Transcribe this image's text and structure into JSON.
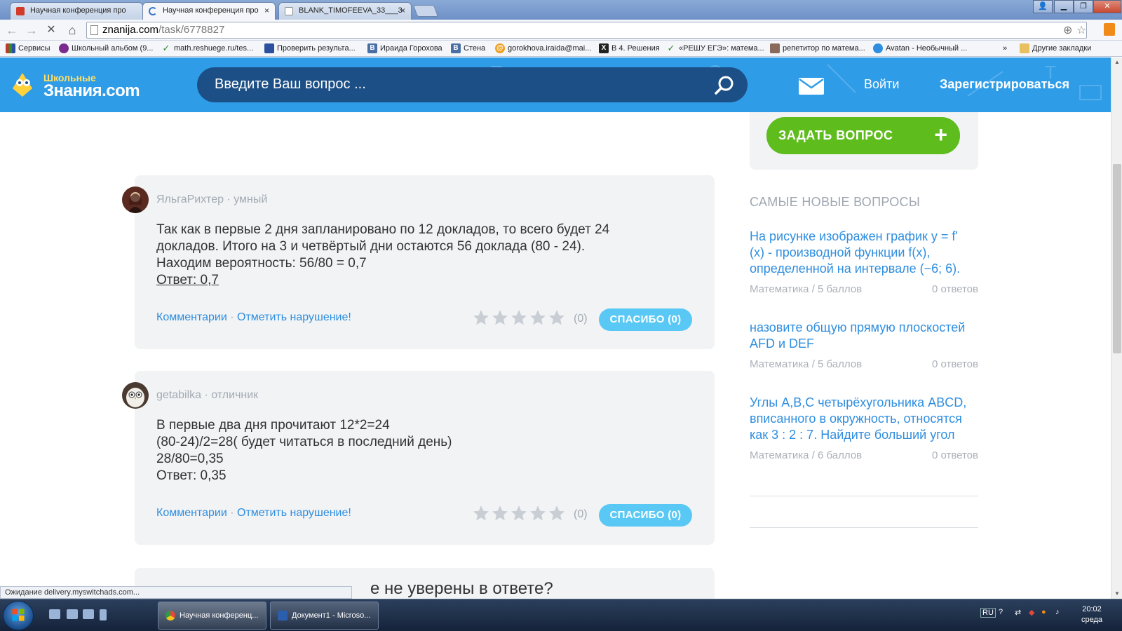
{
  "browser": {
    "tabs": [
      {
        "title": "Научная конференция про",
        "favicon_color": "#d23a2a"
      },
      {
        "title": "Научная конференция про",
        "favicon_color": "#3a73c8"
      },
      {
        "title": "BLANK_TIMOFEEVA_33___3",
        "favicon_color": "#8a8a8a"
      }
    ],
    "url_host": "znanija.com",
    "url_path": "/task/6778827",
    "bookmarks": [
      {
        "label": "Сервисы",
        "icon_color": "#c0392b",
        "glyph": ""
      },
      {
        "label": "Школьный альбом (9...",
        "icon_color": "#7b2b8e",
        "glyph": ""
      },
      {
        "label": "math.reshuege.ru/tes...",
        "icon_color": "#2e8b2e",
        "glyph": "✓"
      },
      {
        "label": "Проверить результа...",
        "icon_color": "#2c4f9e",
        "glyph": ""
      },
      {
        "label": "Ираида Горохова",
        "icon_color": "#4a6fa5",
        "glyph": "В"
      },
      {
        "label": "Стена",
        "icon_color": "#4a6fa5",
        "glyph": "В"
      },
      {
        "label": "gorokhova.iraida@mai...",
        "icon_color": "#f0a020",
        "glyph": "@"
      },
      {
        "label": "В 4. Решения",
        "icon_color": "#222222",
        "glyph": "X"
      },
      {
        "label": "«РЕШУ ЕГЭ»: матема...",
        "icon_color": "#2e8b2e",
        "glyph": "✓"
      },
      {
        "label": "репетитор по матема...",
        "icon_color": "#8a6a5a",
        "glyph": ""
      },
      {
        "label": "Avatan - Необычный ...",
        "icon_color": "#2f8edf",
        "glyph": ""
      },
      {
        "label": "»",
        "icon_color": "",
        "glyph": ""
      },
      {
        "label": "Другие закладки",
        "icon_color": "#e8c060",
        "glyph": ""
      }
    ],
    "status_text": "Ожидание delivery.myswitchads.com..."
  },
  "site": {
    "logo_line1": "Школьные",
    "logo_line2": "Знания.com",
    "search_placeholder": "Введите Ваш вопрос ...",
    "login": "Войти",
    "register": "Зарегистрироваться",
    "ask_button": "ЗАДАТЬ ВОПРОС",
    "ask_plus": "+"
  },
  "answers": [
    {
      "author": "ЯльгаРихтер",
      "rank": "умный",
      "lines": [
        "Так как в первые 2 дня запланировано по 12 докладов, то всего будет 24",
        "докладов. Итого на 3 и четвёртый дни остаются 56 доклада (80 - 24).",
        "Находим вероятность: 56/80 = 0,7",
        "Ответ: 0,7"
      ],
      "comments": "Комментарии",
      "report": "Отметить нарушение!",
      "rating": 0,
      "rating_count": "(0)",
      "thanks": "СПАСИБО (0)"
    },
    {
      "author": "getabilka",
      "rank": "отличник",
      "lines": [
        "В первые два дня прочитают 12*2=24",
        "(80-24)/2=28( будет читаться в последний день)",
        "28/80=0,35",
        "Ответ: 0,35"
      ],
      "comments": "Комментарии",
      "report": "Отметить нарушение!",
      "rating": 0,
      "rating_count": "(0)",
      "thanks": "СПАСИБО (0)"
    }
  ],
  "partial_card_text": "е не уверены в ответе?",
  "sidebar": {
    "newest_title": "САМЫЕ НОВЫЕ ВОПРОСЫ",
    "questions": [
      {
        "lines": [
          "На рисунке изображен график y = f'",
          "(x) - производной функции f(x),",
          "определенной на интервале (−6; 6)."
        ],
        "subject": "Математика",
        "points": "5 баллов",
        "answers": "0 ответов"
      },
      {
        "lines": [
          "назовите общую прямую плоскостей",
          "AFD и DEF"
        ],
        "subject": "Математика",
        "points": "5 баллов",
        "answers": "0 ответов"
      },
      {
        "lines": [
          "Углы A,B,C четырёхугольника ABCD,",
          "вписанного в окружность, относятся",
          "как 3 : 2 : 7. Найдите больший угол"
        ],
        "subject": "Математика",
        "points": "6 баллов",
        "answers": "0 ответов"
      }
    ]
  },
  "taskbar": {
    "tasks": [
      {
        "label": "Научная конференц...",
        "icon_color": "#e04a3a"
      },
      {
        "label": "Документ1 - Microso...",
        "icon_color": "#2b5fad"
      }
    ],
    "lang": "RU",
    "clock_time": "20:02",
    "clock_day": "среда"
  },
  "colors": {
    "header_blue": "#2f9ce8",
    "search_dark": "#1c4f86",
    "link_blue": "#2f8edf",
    "ask_green": "#5ebc1d",
    "thanks_cyan": "#5ac8f5"
  }
}
